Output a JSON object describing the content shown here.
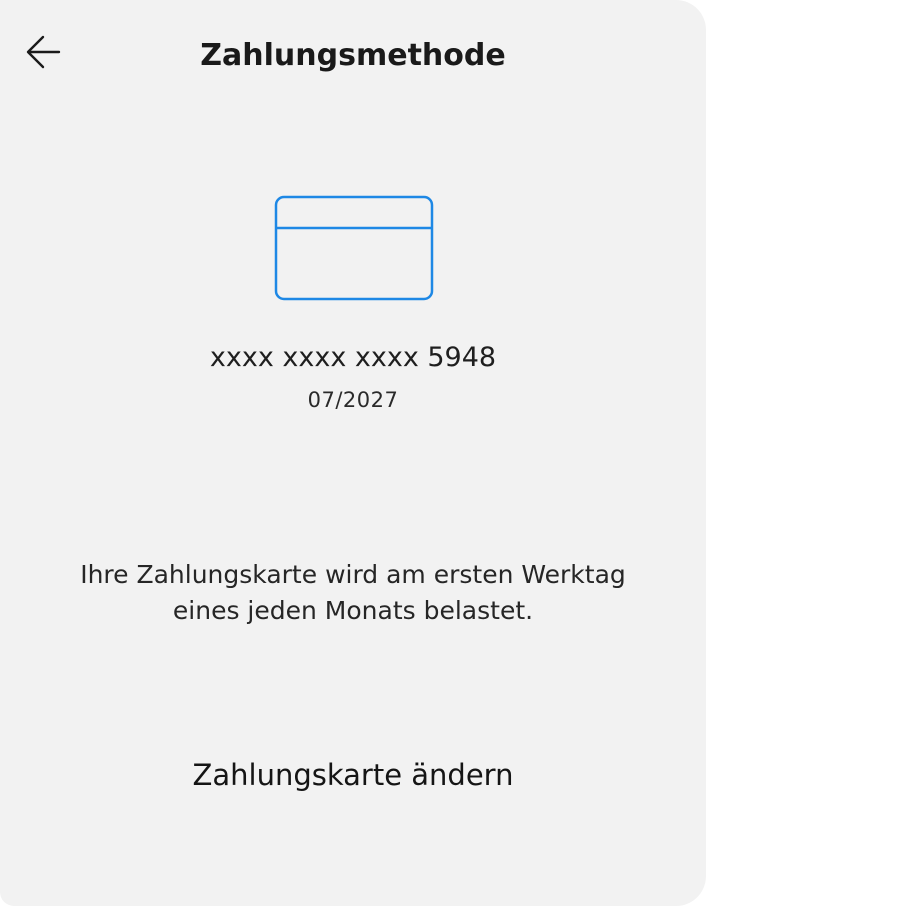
{
  "header": {
    "title": "Zahlungsmethode",
    "back_icon": "arrow-left-icon"
  },
  "card": {
    "icon": "credit-card-icon",
    "icon_color": "#1e88e5",
    "number": "xxxx xxxx xxxx 5948",
    "expiry": "07/2027"
  },
  "info": {
    "text": "Ihre Zahlungskarte wird am ersten Werktag eines jeden Monats belastet."
  },
  "actions": {
    "change_card_label": "Zahlungskarte ändern"
  }
}
